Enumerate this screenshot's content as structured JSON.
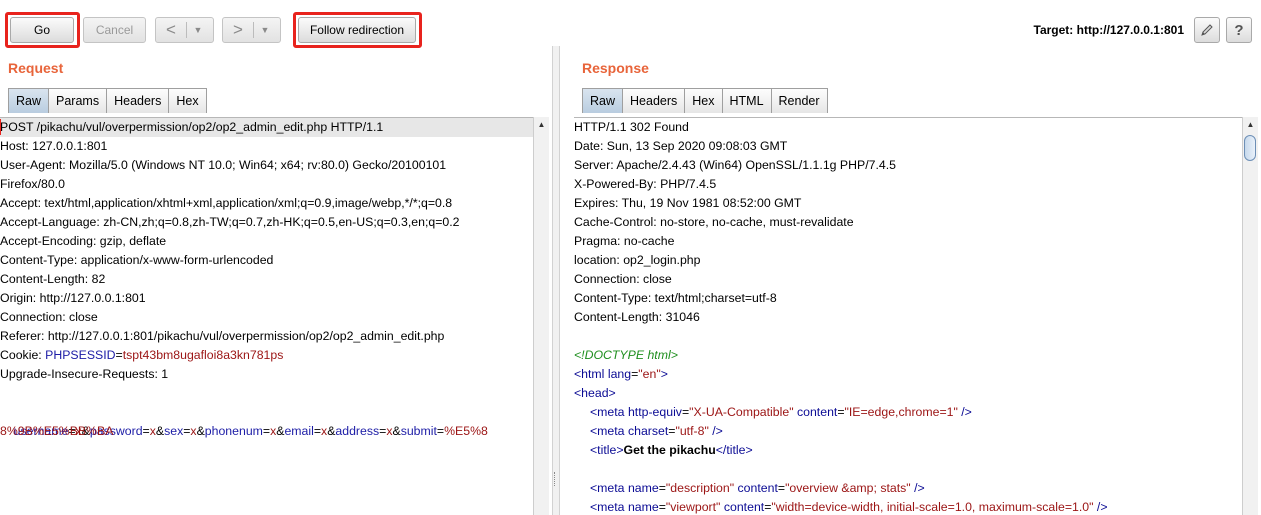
{
  "toolbar": {
    "go_label": "Go",
    "cancel_label": "Cancel",
    "back_arrow": "<",
    "forward_arrow": ">",
    "dropdown_glyph": "▼",
    "follow_label": "Follow redirection",
    "target_label": "Target: http://127.0.0.1:801",
    "edit_icon": "pencil-icon",
    "help_label": "?"
  },
  "request": {
    "title": "Request",
    "tabs": [
      "Raw",
      "Params",
      "Headers",
      "Hex"
    ],
    "active_tab": "Raw",
    "lines": [
      {
        "t": "POST /pikachu/vul/overpermission/op2/op2_admin_edit.php HTTP/1.1"
      },
      {
        "t": "Host: 127.0.0.1:801"
      },
      {
        "t": "User-Agent: Mozilla/5.0 (Windows NT 10.0; Win64; x64; rv:80.0) Gecko/20100101"
      },
      {
        "t": "Firefox/80.0"
      },
      {
        "t": "Accept: text/html,application/xhtml+xml,application/xml;q=0.9,image/webp,*/*;q=0.8"
      },
      {
        "t": "Accept-Language: zh-CN,zh;q=0.8,zh-TW;q=0.7,zh-HK;q=0.5,en-US;q=0.3,en;q=0.2"
      },
      {
        "t": "Accept-Encoding: gzip, deflate"
      },
      {
        "t": "Content-Type: application/x-www-form-urlencoded"
      },
      {
        "t": "Content-Length: 82"
      },
      {
        "t": "Origin: http://127.0.0.1:801"
      },
      {
        "t": "Connection: close"
      },
      {
        "t": "Referer: http://127.0.0.1:801/pikachu/vul/overpermission/op2/op2_admin_edit.php"
      },
      {
        "cookie_name": "PHPSESSID",
        "cookie_value": "tspt43bm8ugafloi8a3kn781ps",
        "prefix": "Cookie: "
      },
      {
        "t": "Upgrade-Insecure-Requests: 1"
      },
      {
        "t": ""
      },
      {
        "params": [
          [
            "username",
            "x"
          ],
          [
            "password",
            "x"
          ],
          [
            "sex",
            "x"
          ],
          [
            "phonenum",
            "x"
          ],
          [
            "email",
            "x"
          ],
          [
            "address",
            "x"
          ],
          [
            "submit",
            "%E5%8"
          ]
        ]
      },
      {
        "v": "8%9B%E5%BB%BA"
      }
    ]
  },
  "response": {
    "title": "Response",
    "tabs": [
      "Raw",
      "Headers",
      "Hex",
      "HTML",
      "Render"
    ],
    "active_tab": "Raw",
    "headers": [
      "HTTP/1.1 302 Found",
      "Date: Sun, 13 Sep 2020 09:08:03 GMT",
      "Server: Apache/2.4.43 (Win64) OpenSSL/1.1.1g PHP/7.4.5",
      "X-Powered-By: PHP/7.4.5",
      "Expires: Thu, 19 Nov 1981 08:52:00 GMT",
      "Cache-Control: no-store, no-cache, must-revalidate",
      "Pragma: no-cache",
      "location: op2_login.php",
      "Connection: close",
      "Content-Type: text/html;charset=utf-8",
      "Content-Length: 31046"
    ],
    "html": {
      "doctype": "<!DOCTYPE html>",
      "html_open_tag": "<html",
      "html_lang_attr": "lang",
      "html_lang_val": "\"en\"",
      "head_open": "<head>",
      "meta1_tag": "<meta",
      "meta1_a1": "http-equiv",
      "meta1_v1": "\"X-UA-Compatible\"",
      "meta1_a2": "content",
      "meta1_v2": "\"IE=edge,chrome=1\"",
      "meta2_a1": "charset",
      "meta2_v1": "\"utf-8\"",
      "title_open": "<title>",
      "title_text": "Get the pikachu",
      "title_close": "</title>",
      "meta3_a1": "name",
      "meta3_v1": "\"description\"",
      "meta3_a2": "content",
      "meta3_v2": "\"overview &amp; stats\"",
      "meta4_v1": "\"viewport\"",
      "meta4_v2": "\"width=device-width, initial-scale=1.0, maximum-scale=1.0\"",
      "self_close": "/>",
      "gt": ">"
    }
  }
}
